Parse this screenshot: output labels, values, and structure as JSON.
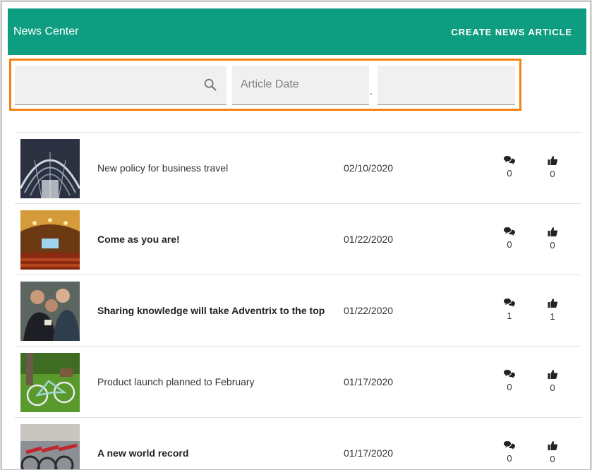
{
  "header": {
    "title": "News Center",
    "create_label": "CREATE NEWS ARTICLE",
    "color": "#0f9d82"
  },
  "filters": {
    "search_placeholder": "",
    "date_from_placeholder": "Article Date",
    "date_to_placeholder": "",
    "separator": "-",
    "highlight_color": "#f58212"
  },
  "articles": [
    {
      "title": "New policy for business travel",
      "date": "02/10/2020",
      "comments": "0",
      "likes": "0",
      "bold": false,
      "image": "station-roof"
    },
    {
      "title": "Come as you are!",
      "date": "01/22/2020",
      "comments": "0",
      "likes": "0",
      "bold": true,
      "image": "auditorium"
    },
    {
      "title": "Sharing knowledge will take Adventrix to the top",
      "date": "01/22/2020",
      "comments": "1",
      "likes": "1",
      "bold": true,
      "image": "people-group"
    },
    {
      "title": "Product launch planned to February",
      "date": "01/17/2020",
      "comments": "0",
      "likes": "0",
      "bold": false,
      "image": "bicycle-grass"
    },
    {
      "title": "A new world record",
      "date": "01/17/2020",
      "comments": "0",
      "likes": "0",
      "bold": true,
      "image": "bicycles-rack"
    }
  ]
}
